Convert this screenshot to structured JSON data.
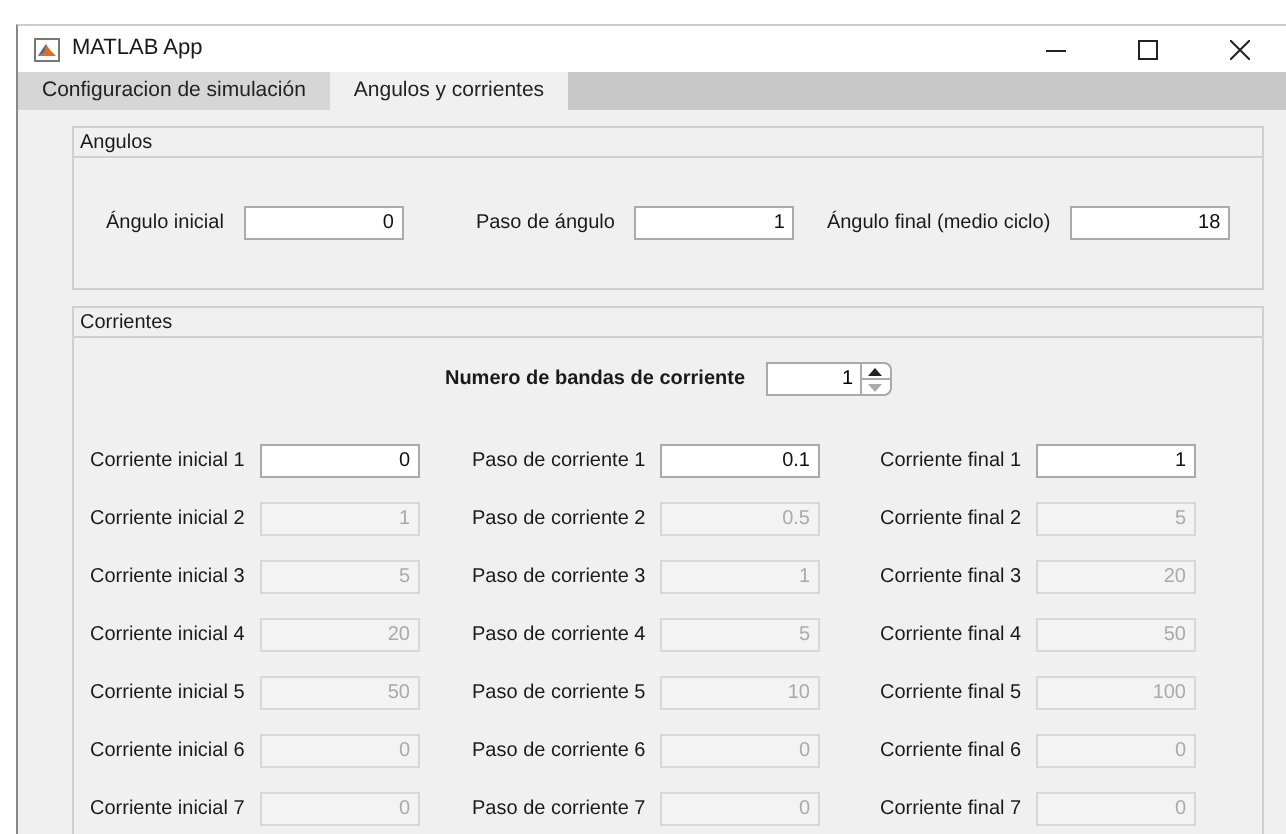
{
  "window": {
    "title": "MATLAB App"
  },
  "tabs": [
    {
      "label": "Configuracion de simulación",
      "selected": false
    },
    {
      "label": "Angulos y corrientes",
      "selected": true
    }
  ],
  "angulos": {
    "title": "Angulos",
    "fields": [
      {
        "label": "Ángulo inicial",
        "value": "0",
        "disabled": false
      },
      {
        "label": "Paso de ángulo",
        "value": "1",
        "disabled": false
      },
      {
        "label": "Ángulo final (medio ciclo)",
        "value": "18",
        "disabled": false
      }
    ]
  },
  "corrientes": {
    "title": "Corrientes",
    "spinner": {
      "label": "Numero de bandas de corriente",
      "value": "1"
    },
    "rows": [
      [
        {
          "label": "Corriente inicial 1",
          "value": "0",
          "disabled": false
        },
        {
          "label": "Paso de corriente 1",
          "value": "0.1",
          "disabled": false
        },
        {
          "label": "Corriente final 1",
          "value": "1",
          "disabled": false
        }
      ],
      [
        {
          "label": "Corriente inicial 2",
          "value": "1",
          "disabled": true
        },
        {
          "label": "Paso de corriente 2",
          "value": "0.5",
          "disabled": true
        },
        {
          "label": "Corriente final 2",
          "value": "5",
          "disabled": true
        }
      ],
      [
        {
          "label": "Corriente inicial 3",
          "value": "5",
          "disabled": true
        },
        {
          "label": "Paso de corriente 3",
          "value": "1",
          "disabled": true
        },
        {
          "label": "Corriente final 3",
          "value": "20",
          "disabled": true
        }
      ],
      [
        {
          "label": "Corriente inicial 4",
          "value": "20",
          "disabled": true
        },
        {
          "label": "Paso de corriente 4",
          "value": "5",
          "disabled": true
        },
        {
          "label": "Corriente final 4",
          "value": "50",
          "disabled": true
        }
      ],
      [
        {
          "label": "Corriente inicial 5",
          "value": "50",
          "disabled": true
        },
        {
          "label": "Paso de corriente 5",
          "value": "10",
          "disabled": true
        },
        {
          "label": "Corriente final 5",
          "value": "100",
          "disabled": true
        }
      ],
      [
        {
          "label": "Corriente inicial 6",
          "value": "0",
          "disabled": true
        },
        {
          "label": "Paso de corriente 6",
          "value": "0",
          "disabled": true
        },
        {
          "label": "Corriente final 6",
          "value": "0",
          "disabled": true
        }
      ],
      [
        {
          "label": "Corriente inicial 7",
          "value": "0",
          "disabled": true
        },
        {
          "label": "Paso de corriente 7",
          "value": "0",
          "disabled": true
        },
        {
          "label": "Corriente final 7",
          "value": "0",
          "disabled": true
        }
      ]
    ]
  }
}
